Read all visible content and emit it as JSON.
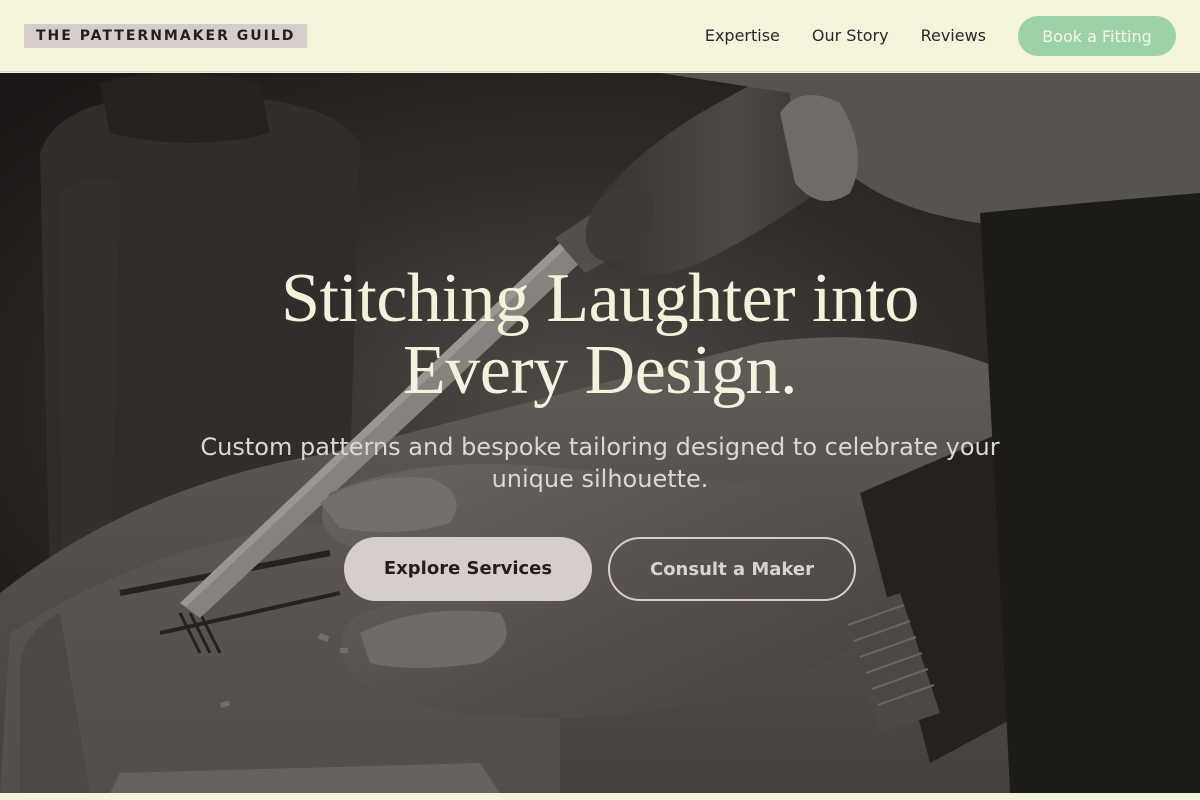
{
  "header": {
    "brand": "THE PATTERNMAKER GUILD",
    "nav_links": [
      "Expertise",
      "Our Story",
      "Reviews"
    ],
    "cta": "Book a Fitting"
  },
  "hero": {
    "title_line1": "Stitching Laughter into",
    "title_line2": "Every Design.",
    "subtitle": "Custom patterns and bespoke tailoring designed to celebrate your unique silhouette.",
    "primary_cta": "Explore Services",
    "secondary_cta": "Consult a Maker",
    "background_photo": "woodcarving-hands-with-chisel"
  },
  "colors": {
    "page_background": "#f4f3dc",
    "brand_chip": "#d6cdcb",
    "book_button": "#9dd1a7",
    "hero_text": "#f4f1dc",
    "primary_button": "#d7cdcb"
  }
}
